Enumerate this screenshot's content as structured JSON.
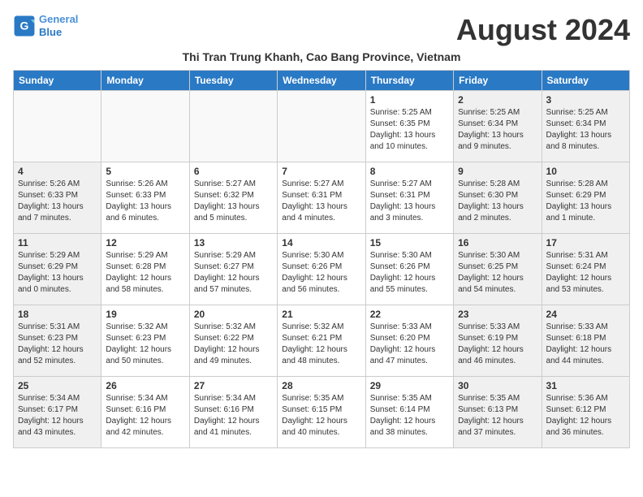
{
  "header": {
    "logo_line1": "General",
    "logo_line2": "Blue",
    "month_title": "August 2024",
    "subtitle": "Thi Tran Trung Khanh, Cao Bang Province, Vietnam"
  },
  "days_of_week": [
    "Sunday",
    "Monday",
    "Tuesday",
    "Wednesday",
    "Thursday",
    "Friday",
    "Saturday"
  ],
  "weeks": [
    [
      {
        "day": "",
        "type": "empty",
        "info": ""
      },
      {
        "day": "",
        "type": "empty",
        "info": ""
      },
      {
        "day": "",
        "type": "empty",
        "info": ""
      },
      {
        "day": "",
        "type": "empty",
        "info": ""
      },
      {
        "day": "1",
        "type": "weekday",
        "info": "Sunrise: 5:25 AM\nSunset: 6:35 PM\nDaylight: 13 hours\nand 10 minutes."
      },
      {
        "day": "2",
        "type": "weekend",
        "info": "Sunrise: 5:25 AM\nSunset: 6:34 PM\nDaylight: 13 hours\nand 9 minutes."
      },
      {
        "day": "3",
        "type": "weekend",
        "info": "Sunrise: 5:25 AM\nSunset: 6:34 PM\nDaylight: 13 hours\nand 8 minutes."
      }
    ],
    [
      {
        "day": "4",
        "type": "weekend",
        "info": "Sunrise: 5:26 AM\nSunset: 6:33 PM\nDaylight: 13 hours\nand 7 minutes."
      },
      {
        "day": "5",
        "type": "weekday",
        "info": "Sunrise: 5:26 AM\nSunset: 6:33 PM\nDaylight: 13 hours\nand 6 minutes."
      },
      {
        "day": "6",
        "type": "weekday",
        "info": "Sunrise: 5:27 AM\nSunset: 6:32 PM\nDaylight: 13 hours\nand 5 minutes."
      },
      {
        "day": "7",
        "type": "weekday",
        "info": "Sunrise: 5:27 AM\nSunset: 6:31 PM\nDaylight: 13 hours\nand 4 minutes."
      },
      {
        "day": "8",
        "type": "weekday",
        "info": "Sunrise: 5:27 AM\nSunset: 6:31 PM\nDaylight: 13 hours\nand 3 minutes."
      },
      {
        "day": "9",
        "type": "weekend",
        "info": "Sunrise: 5:28 AM\nSunset: 6:30 PM\nDaylight: 13 hours\nand 2 minutes."
      },
      {
        "day": "10",
        "type": "weekend",
        "info": "Sunrise: 5:28 AM\nSunset: 6:29 PM\nDaylight: 13 hours\nand 1 minute."
      }
    ],
    [
      {
        "day": "11",
        "type": "weekend",
        "info": "Sunrise: 5:29 AM\nSunset: 6:29 PM\nDaylight: 13 hours\nand 0 minutes."
      },
      {
        "day": "12",
        "type": "weekday",
        "info": "Sunrise: 5:29 AM\nSunset: 6:28 PM\nDaylight: 12 hours\nand 58 minutes."
      },
      {
        "day": "13",
        "type": "weekday",
        "info": "Sunrise: 5:29 AM\nSunset: 6:27 PM\nDaylight: 12 hours\nand 57 minutes."
      },
      {
        "day": "14",
        "type": "weekday",
        "info": "Sunrise: 5:30 AM\nSunset: 6:26 PM\nDaylight: 12 hours\nand 56 minutes."
      },
      {
        "day": "15",
        "type": "weekday",
        "info": "Sunrise: 5:30 AM\nSunset: 6:26 PM\nDaylight: 12 hours\nand 55 minutes."
      },
      {
        "day": "16",
        "type": "weekend",
        "info": "Sunrise: 5:30 AM\nSunset: 6:25 PM\nDaylight: 12 hours\nand 54 minutes."
      },
      {
        "day": "17",
        "type": "weekend",
        "info": "Sunrise: 5:31 AM\nSunset: 6:24 PM\nDaylight: 12 hours\nand 53 minutes."
      }
    ],
    [
      {
        "day": "18",
        "type": "weekend",
        "info": "Sunrise: 5:31 AM\nSunset: 6:23 PM\nDaylight: 12 hours\nand 52 minutes."
      },
      {
        "day": "19",
        "type": "weekday",
        "info": "Sunrise: 5:32 AM\nSunset: 6:23 PM\nDaylight: 12 hours\nand 50 minutes."
      },
      {
        "day": "20",
        "type": "weekday",
        "info": "Sunrise: 5:32 AM\nSunset: 6:22 PM\nDaylight: 12 hours\nand 49 minutes."
      },
      {
        "day": "21",
        "type": "weekday",
        "info": "Sunrise: 5:32 AM\nSunset: 6:21 PM\nDaylight: 12 hours\nand 48 minutes."
      },
      {
        "day": "22",
        "type": "weekday",
        "info": "Sunrise: 5:33 AM\nSunset: 6:20 PM\nDaylight: 12 hours\nand 47 minutes."
      },
      {
        "day": "23",
        "type": "weekend",
        "info": "Sunrise: 5:33 AM\nSunset: 6:19 PM\nDaylight: 12 hours\nand 46 minutes."
      },
      {
        "day": "24",
        "type": "weekend",
        "info": "Sunrise: 5:33 AM\nSunset: 6:18 PM\nDaylight: 12 hours\nand 44 minutes."
      }
    ],
    [
      {
        "day": "25",
        "type": "weekend",
        "info": "Sunrise: 5:34 AM\nSunset: 6:17 PM\nDaylight: 12 hours\nand 43 minutes."
      },
      {
        "day": "26",
        "type": "weekday",
        "info": "Sunrise: 5:34 AM\nSunset: 6:16 PM\nDaylight: 12 hours\nand 42 minutes."
      },
      {
        "day": "27",
        "type": "weekday",
        "info": "Sunrise: 5:34 AM\nSunset: 6:16 PM\nDaylight: 12 hours\nand 41 minutes."
      },
      {
        "day": "28",
        "type": "weekday",
        "info": "Sunrise: 5:35 AM\nSunset: 6:15 PM\nDaylight: 12 hours\nand 40 minutes."
      },
      {
        "day": "29",
        "type": "weekday",
        "info": "Sunrise: 5:35 AM\nSunset: 6:14 PM\nDaylight: 12 hours\nand 38 minutes."
      },
      {
        "day": "30",
        "type": "weekend",
        "info": "Sunrise: 5:35 AM\nSunset: 6:13 PM\nDaylight: 12 hours\nand 37 minutes."
      },
      {
        "day": "31",
        "type": "weekend",
        "info": "Sunrise: 5:36 AM\nSunset: 6:12 PM\nDaylight: 12 hours\nand 36 minutes."
      }
    ]
  ]
}
